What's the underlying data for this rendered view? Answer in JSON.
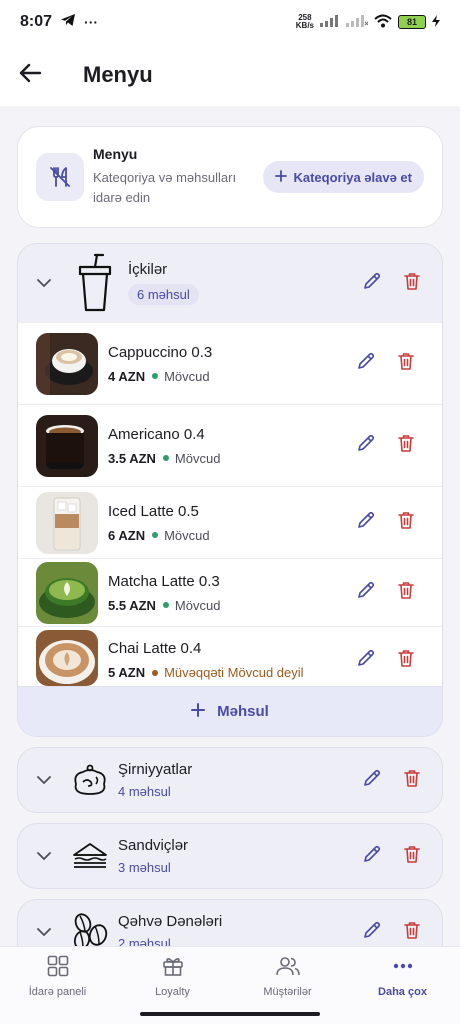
{
  "status_bar": {
    "time": "8:07",
    "network_speed_value": "258",
    "network_speed_unit": "KB/s",
    "battery": "81"
  },
  "app_bar": {
    "title": "Menyu"
  },
  "header": {
    "title": "Menyu",
    "subtitle": "Kateqoriya və məhsulları idarə edin",
    "add_category_label": "Kateqoriya əlavə et"
  },
  "categories": [
    {
      "name": "İçkilər",
      "count": "6 məhsul",
      "icon": "cup-icon",
      "expanded": true,
      "products": [
        {
          "name": "Cappuccino 0.3",
          "price": "4 AZN",
          "status": "Mövcud",
          "status_color": "#2e9e6b",
          "image": "cappuccino"
        },
        {
          "name": "Americano 0.4",
          "price": "3.5 AZN",
          "status": "Mövcud",
          "status_color": "#2e9e6b",
          "image": "americano"
        },
        {
          "name": "Iced Latte 0.5",
          "price": "6 AZN",
          "status": "Mövcud",
          "status_color": "#2e9e6b",
          "image": "iced-latte"
        },
        {
          "name": "Matcha Latte 0.3",
          "price": "5.5 AZN",
          "status": "Mövcud",
          "status_color": "#2e9e6b",
          "image": "matcha-latte"
        },
        {
          "name": "Chai Latte 0.4",
          "price": "5 AZN",
          "status": "Müvəqqəti Mövcud deyil",
          "status_color": "#a05a1e",
          "image": "chai-latte"
        }
      ],
      "add_product_label": "Məhsul"
    },
    {
      "name": "Şirniyyatlar",
      "count": "4 məhsul",
      "icon": "cinnamon-roll-icon",
      "expanded": false
    },
    {
      "name": "Sandviçlər",
      "count": "3 məhsul",
      "icon": "sandwich-icon",
      "expanded": false
    },
    {
      "name": "Qəhvə Dənələri",
      "count": "2 məhsul",
      "icon": "coffee-beans-icon",
      "expanded": false
    }
  ],
  "bottom_nav": [
    {
      "label": "İdarə paneli",
      "icon": "dashboard-icon",
      "active": false
    },
    {
      "label": "Loyalty",
      "icon": "gift-icon",
      "active": false
    },
    {
      "label": "Müştərilər",
      "icon": "users-icon",
      "active": false
    },
    {
      "label": "Daha çox",
      "icon": "more-icon",
      "active": true
    }
  ],
  "colors": {
    "accent": "#4a4aa8",
    "delete": "#c83b3b",
    "available": "#2e9e6b",
    "unavailable": "#a05a1e"
  }
}
